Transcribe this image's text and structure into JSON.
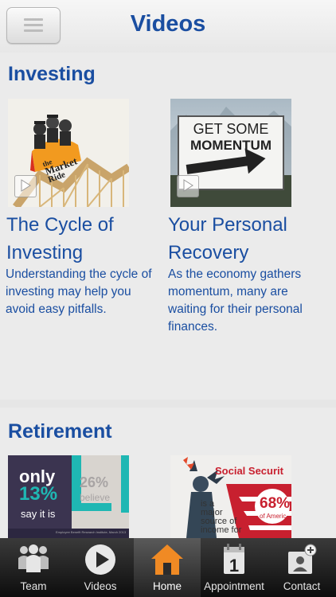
{
  "header": {
    "title": "Videos",
    "menu_icon": "hamburger-icon"
  },
  "sections": [
    {
      "title": "Investing",
      "cards": [
        {
          "title": "The Cycle of Investing",
          "description": "Understanding the cycle of investing may help you avoid easy pitfalls.",
          "thumb_text": [
            "the",
            "Market",
            "Ride"
          ]
        },
        {
          "title": "Your Personal Recovery",
          "description": "As the economy gathers momentum, many are waiting for their personal finances.",
          "thumb_text": [
            "GET SOME",
            "MOMENTUM"
          ]
        }
      ]
    },
    {
      "title": "Retirement",
      "cards": [
        {
          "thumb_text": [
            "only",
            "13%",
            "say it is",
            "26%",
            "believe",
            "Employee Benefit Research Institute, March 2013"
          ]
        },
        {
          "thumb_text": [
            "Social Securit",
            "is a",
            "major",
            "source of",
            "income for",
            "68%",
            "of",
            "Americ"
          ]
        }
      ]
    }
  ],
  "tabs": [
    {
      "label": "Team",
      "icon": "team-icon",
      "active": false
    },
    {
      "label": "Videos",
      "icon": "play-icon",
      "active": false
    },
    {
      "label": "Home",
      "icon": "home-icon",
      "active": true
    },
    {
      "label": "Appointment",
      "icon": "calendar-icon",
      "active": false
    },
    {
      "label": "Contact",
      "icon": "contact-icon",
      "active": false
    }
  ],
  "colors": {
    "title_blue": "#1a4ea1",
    "home_orange": "#f08a24"
  }
}
